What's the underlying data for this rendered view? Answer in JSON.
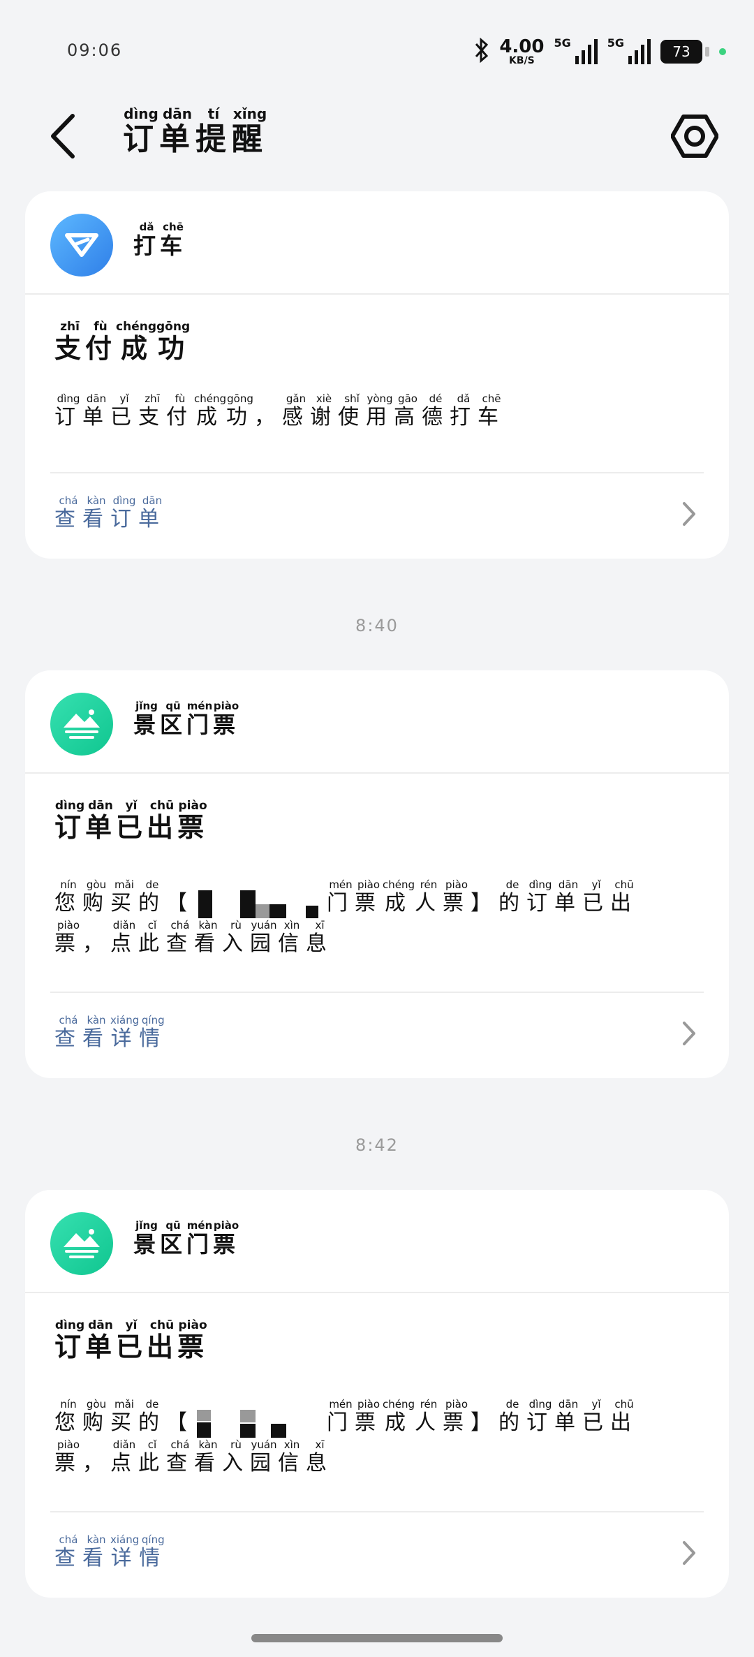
{
  "status_bar": {
    "time": "09:06",
    "speed_value": "4.00",
    "speed_unit": "KB/S",
    "net1": "5G",
    "net2": "5G",
    "battery": "73"
  },
  "header": {
    "title": [
      {
        "c": "订",
        "p": "dìng"
      },
      {
        "c": "单",
        "p": "dān"
      },
      {
        "c": "提",
        "p": "tí"
      },
      {
        "c": "醒",
        "p": "xǐng"
      }
    ]
  },
  "cards": [
    {
      "app": [
        {
          "c": "打",
          "p": "dǎ"
        },
        {
          "c": "车",
          "p": "chē"
        }
      ],
      "title": [
        {
          "c": "支",
          "p": "zhī"
        },
        {
          "c": "付",
          "p": "fù"
        },
        {
          "c": "成",
          "p": "chéng"
        },
        {
          "c": "功",
          "p": "gōng"
        }
      ],
      "body": [
        {
          "c": "订",
          "p": "dìng"
        },
        {
          "c": "单",
          "p": "dān"
        },
        {
          "c": "已",
          "p": "yǐ"
        },
        {
          "c": "支",
          "p": "zhī"
        },
        {
          "c": "付",
          "p": "fù"
        },
        {
          "c": "成",
          "p": "chéng"
        },
        {
          "c": "功",
          "p": "gōng"
        },
        {
          "c": "，",
          "p": ""
        },
        {
          "c": "感",
          "p": "gǎn"
        },
        {
          "c": "谢",
          "p": "xiè"
        },
        {
          "c": "使",
          "p": "shǐ"
        },
        {
          "c": "用",
          "p": "yòng"
        },
        {
          "c": "高",
          "p": "gāo"
        },
        {
          "c": "德",
          "p": "dé"
        },
        {
          "c": "打",
          "p": "dǎ"
        },
        {
          "c": "车",
          "p": "chē"
        }
      ],
      "link": [
        {
          "c": "查",
          "p": "chá"
        },
        {
          "c": "看",
          "p": "kàn"
        },
        {
          "c": "订",
          "p": "dìng"
        },
        {
          "c": "单",
          "p": "dān"
        }
      ]
    },
    {
      "timestamp": "8:40",
      "app": [
        {
          "c": "景",
          "p": "jǐng"
        },
        {
          "c": "区",
          "p": "qū"
        },
        {
          "c": "门",
          "p": "mén"
        },
        {
          "c": "票",
          "p": "piào"
        }
      ],
      "title": [
        {
          "c": "订",
          "p": "dìng"
        },
        {
          "c": "单",
          "p": "dān"
        },
        {
          "c": "已",
          "p": "yǐ"
        },
        {
          "c": "出",
          "p": "chū"
        },
        {
          "c": "票",
          "p": "piào"
        }
      ],
      "body_pre": [
        {
          "c": "您",
          "p": "nín"
        },
        {
          "c": "购",
          "p": "gòu"
        },
        {
          "c": "买",
          "p": "mǎi"
        },
        {
          "c": "的",
          "p": "de"
        },
        {
          "c": "【",
          "p": ""
        }
      ],
      "body_post": [
        {
          "c": "门",
          "p": "mén"
        },
        {
          "c": "票",
          "p": "piào"
        },
        {
          "c": "成",
          "p": "chéng"
        },
        {
          "c": "人",
          "p": "rén"
        },
        {
          "c": "票",
          "p": "piào"
        },
        {
          "c": "】",
          "p": ""
        },
        {
          "c": "的",
          "p": "de"
        },
        {
          "c": "订",
          "p": "dìng"
        },
        {
          "c": "单",
          "p": "dān"
        },
        {
          "c": "已",
          "p": "yǐ"
        },
        {
          "c": "出",
          "p": "chū"
        }
      ],
      "body_line2": [
        {
          "c": "票",
          "p": "piào"
        },
        {
          "c": "，",
          "p": ""
        },
        {
          "c": "点",
          "p": "diǎn"
        },
        {
          "c": "此",
          "p": "cǐ"
        },
        {
          "c": "查",
          "p": "chá"
        },
        {
          "c": "看",
          "p": "kàn"
        },
        {
          "c": "入",
          "p": "rù"
        },
        {
          "c": "园",
          "p": "yuán"
        },
        {
          "c": "信",
          "p": "xìn"
        },
        {
          "c": "息",
          "p": "xī"
        }
      ],
      "link": [
        {
          "c": "查",
          "p": "chá"
        },
        {
          "c": "看",
          "p": "kàn"
        },
        {
          "c": "详",
          "p": "xiáng"
        },
        {
          "c": "情",
          "p": "qíng"
        }
      ]
    },
    {
      "timestamp": "8:42",
      "app": [
        {
          "c": "景",
          "p": "jǐng"
        },
        {
          "c": "区",
          "p": "qū"
        },
        {
          "c": "门",
          "p": "mén"
        },
        {
          "c": "票",
          "p": "piào"
        }
      ],
      "title": [
        {
          "c": "订",
          "p": "dìng"
        },
        {
          "c": "单",
          "p": "dān"
        },
        {
          "c": "已",
          "p": "yǐ"
        },
        {
          "c": "出",
          "p": "chū"
        },
        {
          "c": "票",
          "p": "piào"
        }
      ],
      "body_pre": [
        {
          "c": "您",
          "p": "nín"
        },
        {
          "c": "购",
          "p": "gòu"
        },
        {
          "c": "买",
          "p": "mǎi"
        },
        {
          "c": "的",
          "p": "de"
        },
        {
          "c": "【",
          "p": ""
        }
      ],
      "body_post": [
        {
          "c": "门",
          "p": "mén"
        },
        {
          "c": "票",
          "p": "piào"
        },
        {
          "c": "成",
          "p": "chéng"
        },
        {
          "c": "人",
          "p": "rén"
        },
        {
          "c": "票",
          "p": "piào"
        },
        {
          "c": "】",
          "p": ""
        },
        {
          "c": "的",
          "p": "de"
        },
        {
          "c": "订",
          "p": "dìng"
        },
        {
          "c": "单",
          "p": "dān"
        },
        {
          "c": "已",
          "p": "yǐ"
        },
        {
          "c": "出",
          "p": "chū"
        }
      ],
      "body_line2": [
        {
          "c": "票",
          "p": "piào"
        },
        {
          "c": "，",
          "p": ""
        },
        {
          "c": "点",
          "p": "diǎn"
        },
        {
          "c": "此",
          "p": "cǐ"
        },
        {
          "c": "查",
          "p": "chá"
        },
        {
          "c": "看",
          "p": "kàn"
        },
        {
          "c": "入",
          "p": "rù"
        },
        {
          "c": "园",
          "p": "yuán"
        },
        {
          "c": "信",
          "p": "xìn"
        },
        {
          "c": "息",
          "p": "xī"
        }
      ],
      "link": [
        {
          "c": "查",
          "p": "chá"
        },
        {
          "c": "看",
          "p": "kàn"
        },
        {
          "c": "详",
          "p": "xiáng"
        },
        {
          "c": "情",
          "p": "qíng"
        }
      ]
    }
  ],
  "colors": {
    "background": "#f3f4f6",
    "link": "#4a6a9c",
    "taxi_icon": "#3a8ef0",
    "scenic_icon": "#1fcf9c",
    "online_dot": "#3ad27f"
  },
  "icons": {
    "back": "chevron-left-icon",
    "settings": "hexagon-settings-icon",
    "taxi": "taxi-app-icon",
    "scenic": "mountain-app-icon",
    "more": "chevron-right-icon"
  }
}
